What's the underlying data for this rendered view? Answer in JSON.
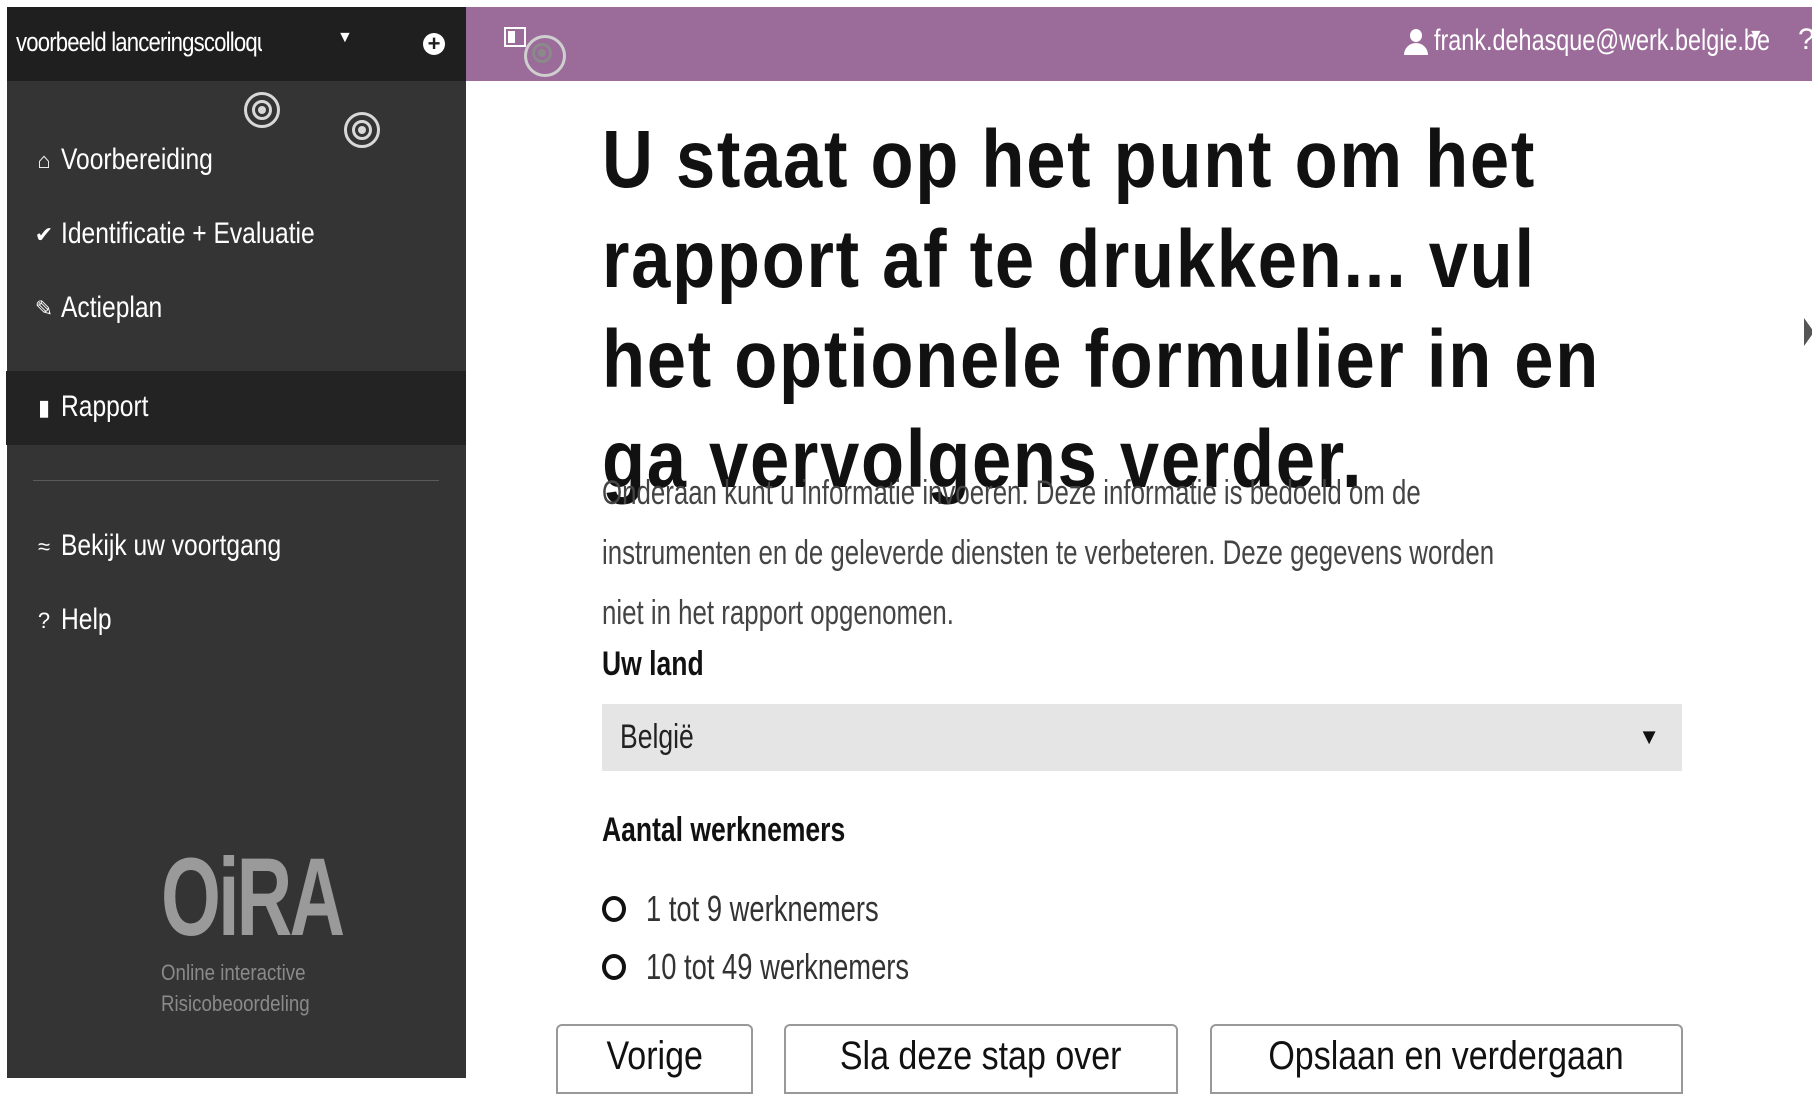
{
  "sidebar": {
    "survey_title": "voorbeeld lanceringscolloquiu...",
    "caret": "▼",
    "add_symbol": "+",
    "nav": [
      {
        "label": "Voorbereiding",
        "icon": "home-icon",
        "glyph": "⌂"
      },
      {
        "label": "Identificatie + Evaluatie",
        "icon": "check-circle-icon",
        "glyph": "✔"
      },
      {
        "label": "Actieplan",
        "icon": "pencil-icon",
        "glyph": "✎"
      },
      {
        "label": "Rapport",
        "icon": "document-icon",
        "glyph": "▮"
      }
    ],
    "secondary": [
      {
        "label": "Bekijk uw voortgang",
        "icon": "progress-icon",
        "glyph": "≈"
      },
      {
        "label": "Help",
        "icon": "help-circle-icon",
        "glyph": "?"
      }
    ],
    "logo_text": "OiRA",
    "logo_sub1": "Online interactive",
    "logo_sub2": "Risicobeoordeling"
  },
  "topbar": {
    "user_email": "frank.dehasque@werk.belgie.be",
    "caret": "▼",
    "help": "?"
  },
  "main": {
    "title": "U staat op het punt om het rapport af te drukken... vul het optionele formulier in en ga vervolgens verder.",
    "intro": "Onderaan kunt u informatie invoeren. Deze informatie is bedoeld om de instrumenten en de geleverde diensten te verbeteren. Deze gegevens worden niet in het rapport opgenomen.",
    "country_label": "Uw land",
    "country_value": "België",
    "select_arrow": "▼",
    "employees_label": "Aantal werknemers",
    "employee_options": [
      "1 tot 9 werknemers",
      "10 tot 49 werknemers"
    ],
    "buttons": {
      "previous": "Vorige",
      "skip": "Sla deze stap over",
      "save_continue": "Opslaan en verdergaan"
    }
  },
  "colors": {
    "topbar": "#9b6b9a",
    "sidebar": "#343434",
    "sidebar_header": "#1f1f1f"
  }
}
